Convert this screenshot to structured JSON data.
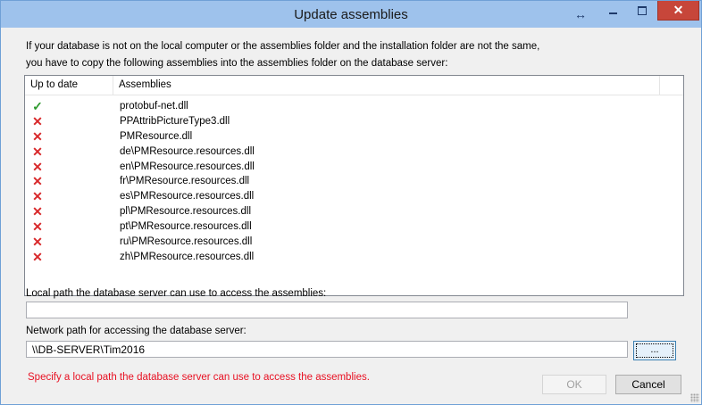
{
  "window": {
    "title": "Update assemblies",
    "resize_glyph": "↔",
    "close_glyph": "✕"
  },
  "intro": {
    "line1": "If your database is not on the local computer or the assemblies folder and the installation folder are not the same,",
    "line2": "you have to copy the following assemblies into the assemblies folder on the database server:"
  },
  "table": {
    "columns": [
      "Up to date",
      "Assemblies"
    ],
    "rows": [
      {
        "status": "ok",
        "icon": "check-icon",
        "name": "protobuf-net.dll"
      },
      {
        "status": "missing",
        "icon": "cross-icon",
        "name": "PPAttribPictureType3.dll"
      },
      {
        "status": "missing",
        "icon": "cross-icon",
        "name": "PMResource.dll"
      },
      {
        "status": "missing",
        "icon": "cross-icon",
        "name": "de\\PMResource.resources.dll"
      },
      {
        "status": "missing",
        "icon": "cross-icon",
        "name": "en\\PMResource.resources.dll"
      },
      {
        "status": "missing",
        "icon": "cross-icon",
        "name": "fr\\PMResource.resources.dll"
      },
      {
        "status": "missing",
        "icon": "cross-icon",
        "name": "es\\PMResource.resources.dll"
      },
      {
        "status": "missing",
        "icon": "cross-icon",
        "name": "pl\\PMResource.resources.dll"
      },
      {
        "status": "missing",
        "icon": "cross-icon",
        "name": "pt\\PMResource.resources.dll"
      },
      {
        "status": "missing",
        "icon": "cross-icon",
        "name": "ru\\PMResource.resources.dll"
      },
      {
        "status": "missing",
        "icon": "cross-icon",
        "name": "zh\\PMResource.resources.dll"
      }
    ]
  },
  "local_path": {
    "label": "Local path the database server can use to access the assemblies:",
    "value": ""
  },
  "network_path": {
    "label": "Network path for accessing the database server:",
    "value": "\\\\DB-SERVER\\Tim2016",
    "browse_label": "..."
  },
  "error_text": "Specify a local path the database server can use to access the assemblies.",
  "buttons": {
    "ok": "OK",
    "cancel": "Cancel"
  },
  "colors": {
    "check": "#2e9a2e",
    "cross": "#d8282a",
    "error": "#e81123",
    "titlebar": "#9ec2ec",
    "close": "#c7463a"
  }
}
